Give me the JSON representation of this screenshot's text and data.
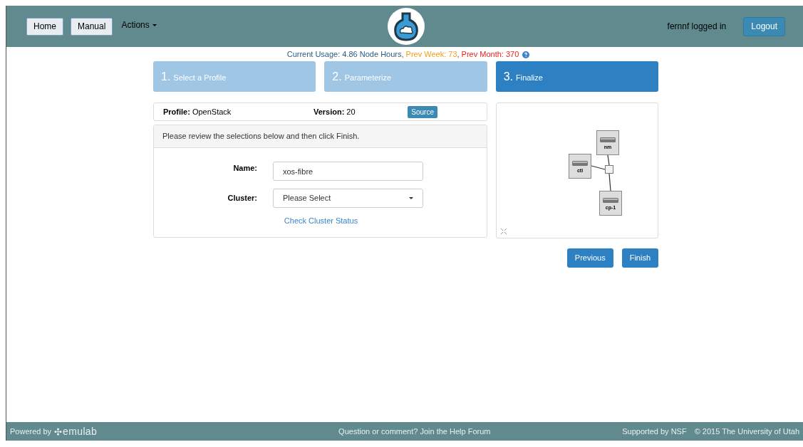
{
  "navbar": {
    "buttons": [
      "Home",
      "Manual"
    ],
    "menu": "Actions",
    "user": "fernnf logged in",
    "logout": "Logout"
  },
  "usage": {
    "current": "Current Usage: 4.86 Node Hours,",
    "week": "Prev Week: 73",
    "sep": ",",
    "month": "Prev Month: 370"
  },
  "steps": [
    {
      "number": "1.",
      "label": "Select a Profile",
      "selected": false
    },
    {
      "number": "2.",
      "label": "Parameterize",
      "selected": false
    },
    {
      "number": "3.",
      "label": "Finalize",
      "selected": true
    }
  ],
  "profile": {
    "label": "Profile:",
    "value": "OpenStack",
    "version_label": "Version:",
    "version": "20",
    "source": "Source"
  },
  "form": {
    "intro": "Please review the selections below and then click Finish.",
    "name_label": "Name:",
    "name_value": "xos-fibre",
    "cluster_label": "Cluster:",
    "cluster_value": "Please Select",
    "link": "Check Cluster Status"
  },
  "topology": {
    "nodes": [
      {
        "label": "nm"
      },
      {
        "label": "ctl"
      },
      {
        "label": "cp-1"
      }
    ]
  },
  "actions": [
    "Previous",
    "Finish"
  ],
  "footer": {
    "powered": "Powered by",
    "logo": "emulab",
    "help": "Question or comment? Join the Help Forum",
    "nsf": "Supported by NSF",
    "copyright": "© 2015 The University of Utah"
  }
}
